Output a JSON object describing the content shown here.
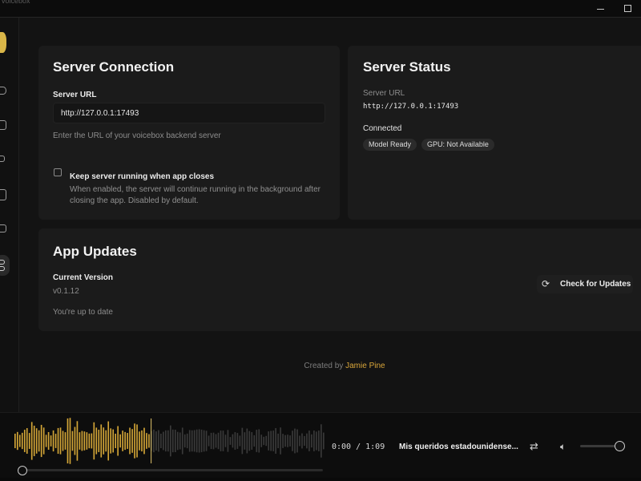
{
  "window": {
    "title_ghost": "voicebox"
  },
  "connection": {
    "title": "Server Connection",
    "url_label": "Server URL",
    "url_value": "http://127.0.0.1:17493",
    "url_help": "Enter the URL of your voicebox backend server",
    "keep_running_label": "Keep server running when app closes",
    "keep_running_desc_1": "When enabled, the server will continue running in the background after",
    "keep_running_desc_2": "closing the app. Disabled by default.",
    "keep_running_checked": false
  },
  "status": {
    "title": "Server Status",
    "url_label": "Server URL",
    "url_value": "http://127.0.0.1:17493",
    "state": "Connected",
    "badges": [
      "Model Ready",
      "GPU: Not Available"
    ]
  },
  "updates": {
    "title": "App Updates",
    "version_label": "Current Version",
    "version_value": "v0.1.12",
    "status_text": "You're up to date",
    "check_button": "Check for Updates"
  },
  "footer": {
    "credit_prefix": "Created by",
    "credit_author": "Jamie Pine"
  },
  "player": {
    "time": "0:00 / 1:09",
    "track_title": "Mis queridos estadounidense...",
    "progress": 0.0,
    "played_fraction": 0.44,
    "volume": 0.9,
    "wave_color": "#d4a637",
    "wave_dim_color": "#3a3a3a"
  },
  "colors": {
    "accent": "#d9a63a",
    "card": "#1b1b1b",
    "background": "#131313"
  }
}
